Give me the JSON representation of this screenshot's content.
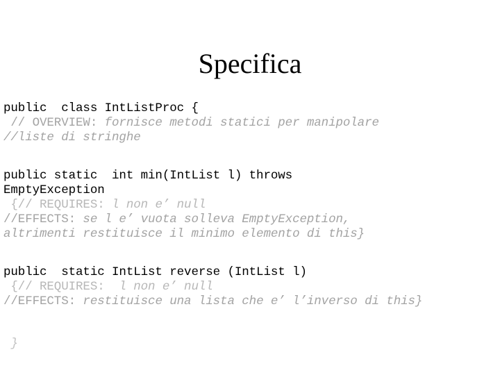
{
  "slide": {
    "title": "Specifica",
    "background_color": "#ffffff",
    "title_color": "#000000",
    "code_color": "#000000",
    "comment_color": "#a3a3a3",
    "comment_light_color": "#b7b7b7",
    "closing_brace_color": "#c2c2c2"
  },
  "code": {
    "class_decl": "public  class IntListProc {",
    "overview_marker": " // OVERVIEW: ",
    "overview_text": "fornisce metodi statici per manipolare",
    "overview_cont": "//liste di stringhe",
    "min_sig_line1": "public static  int min(IntList l) throws",
    "min_sig_line2": "EmptyException",
    "min_requires_marker": " {// REQUIRES: ",
    "min_requires_text": "l non e’ null",
    "min_effects_marker": "//EFFECTS: ",
    "min_effects_text": "se l e’ vuota solleva EmptyException,",
    "min_effects_cont": "altrimenti restituisce il minimo elemento di this}",
    "reverse_sig": "public  static IntList reverse (IntList l)",
    "reverse_requires_marker": " {// REQUIRES:  ",
    "reverse_requires_text": "l non e’ null",
    "reverse_effects_marker": "//EFFECTS: ",
    "reverse_effects_text": "restituisce una lista che e’ l’inverso di this}",
    "class_close": " }"
  }
}
